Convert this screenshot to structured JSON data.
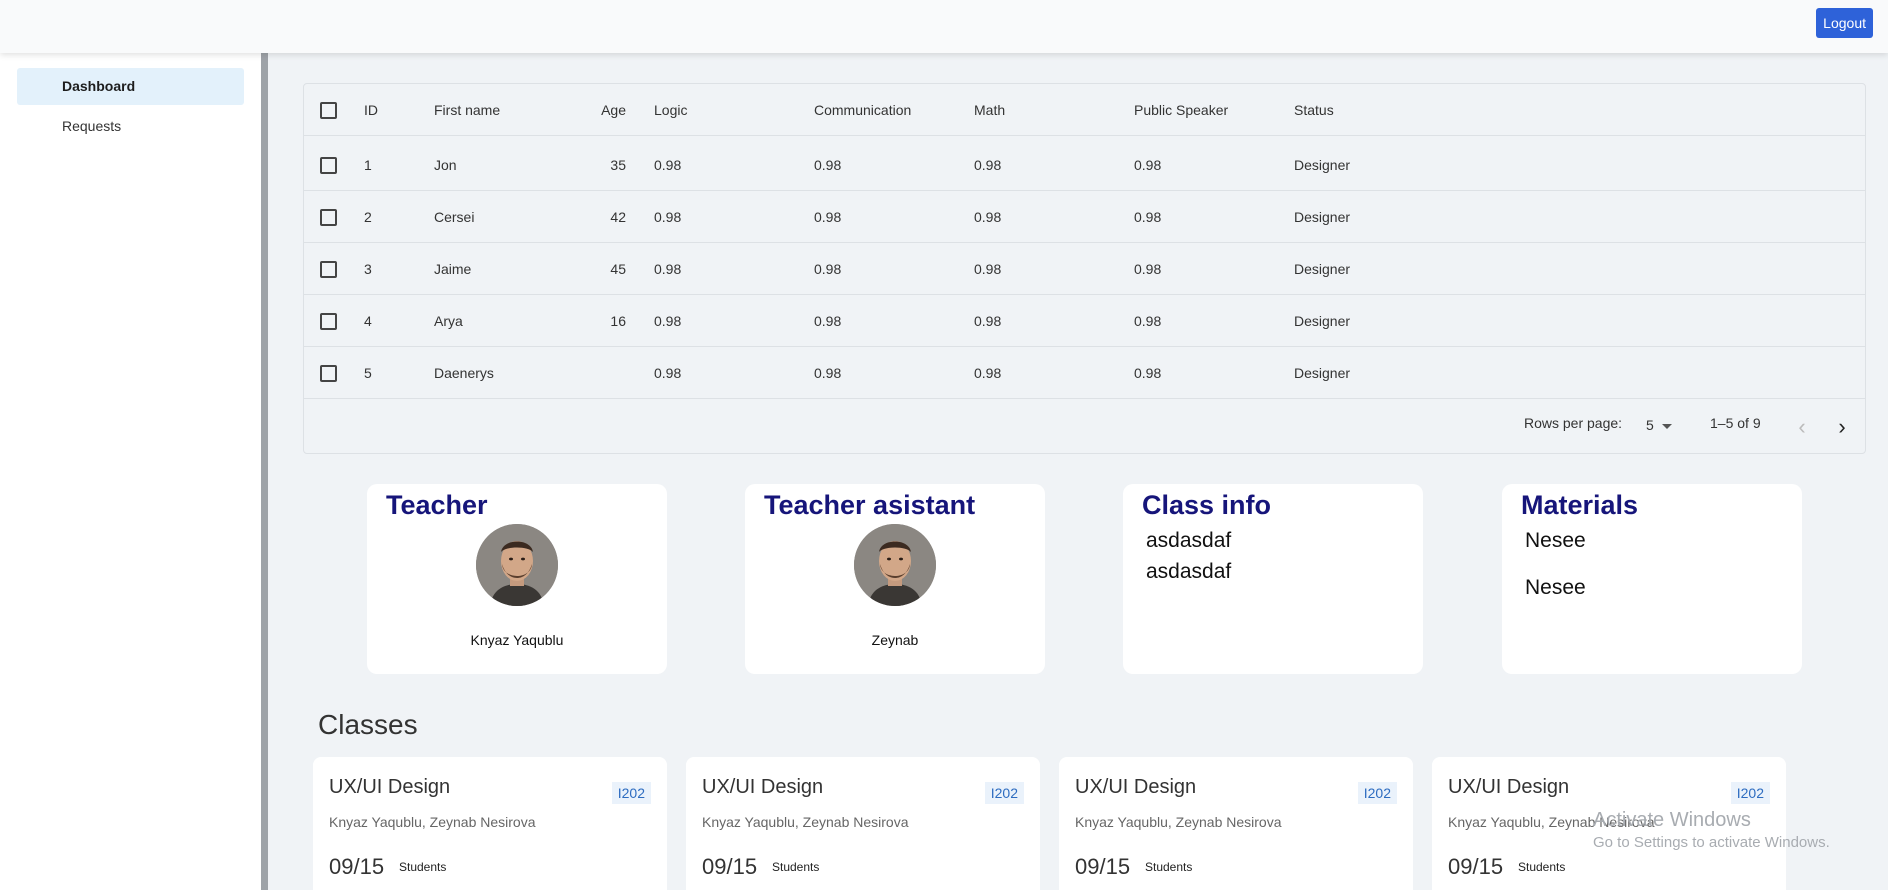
{
  "topbar": {
    "logout_label": "Logout"
  },
  "sidebar": {
    "items": [
      {
        "label": "Dashboard",
        "active": true
      },
      {
        "label": "Requests",
        "active": false
      }
    ]
  },
  "table": {
    "columns": [
      "ID",
      "First name",
      "Age",
      "Logic",
      "Communication",
      "Math",
      "Public Speaker",
      "Status"
    ],
    "rows": [
      {
        "id": "1",
        "first_name": "Jon",
        "age": "35",
        "logic": "0.98",
        "communication": "0.98",
        "math": "0.98",
        "public_speaker": "0.98",
        "status": "Designer"
      },
      {
        "id": "2",
        "first_name": "Cersei",
        "age": "42",
        "logic": "0.98",
        "communication": "0.98",
        "math": "0.98",
        "public_speaker": "0.98",
        "status": "Designer"
      },
      {
        "id": "3",
        "first_name": "Jaime",
        "age": "45",
        "logic": "0.98",
        "communication": "0.98",
        "math": "0.98",
        "public_speaker": "0.98",
        "status": "Designer"
      },
      {
        "id": "4",
        "first_name": "Arya",
        "age": "16",
        "logic": "0.98",
        "communication": "0.98",
        "math": "0.98",
        "public_speaker": "0.98",
        "status": "Designer"
      },
      {
        "id": "5",
        "first_name": "Daenerys",
        "age": "",
        "logic": "0.98",
        "communication": "0.98",
        "math": "0.98",
        "public_speaker": "0.98",
        "status": "Designer"
      }
    ],
    "footer": {
      "rows_per_page_label": "Rows per page:",
      "rows_per_page_value": "5",
      "range_text": "1–5 of 9",
      "prev_icon": "‹",
      "next_icon": "›"
    }
  },
  "cards": {
    "teacher": {
      "title": "Teacher",
      "name": "Knyaz Yaqublu",
      "icon": "avatar"
    },
    "assistant": {
      "title": "Teacher asistant",
      "name": "Zeynab",
      "icon": "avatar"
    },
    "class_info": {
      "title": "Class info",
      "lines": [
        "asdasdaf",
        "asdasdaf"
      ]
    },
    "materials": {
      "title": "Materials",
      "lines": [
        "Nesee",
        "Nesee"
      ]
    }
  },
  "classes": {
    "heading": "Classes",
    "items": [
      {
        "title": "UX/UI Design",
        "room": "I202",
        "teachers": "Knyaz Yaqublu, Zeynab Nesirova",
        "count": "09/15",
        "count_label": "Students"
      },
      {
        "title": "UX/UI Design",
        "room": "I202",
        "teachers": "Knyaz Yaqublu, Zeynab Nesirova",
        "count": "09/15",
        "count_label": "Students"
      },
      {
        "title": "UX/UI Design",
        "room": "I202",
        "teachers": "Knyaz Yaqublu, Zeynab Nesirova",
        "count": "09/15",
        "count_label": "Students"
      },
      {
        "title": "UX/UI Design",
        "room": "I202",
        "teachers": "Knyaz Yaqublu, Zeynab Nesirova",
        "count": "09/15",
        "count_label": "Students"
      }
    ]
  },
  "watermark": {
    "title": "Activate Windows",
    "subtitle": "Go to Settings to activate Windows."
  },
  "colors": {
    "accent": "#2e62d9",
    "title_navy": "#16157a",
    "sidebar_active_bg": "#e3f1fb",
    "divider": "#9ea3a8"
  }
}
